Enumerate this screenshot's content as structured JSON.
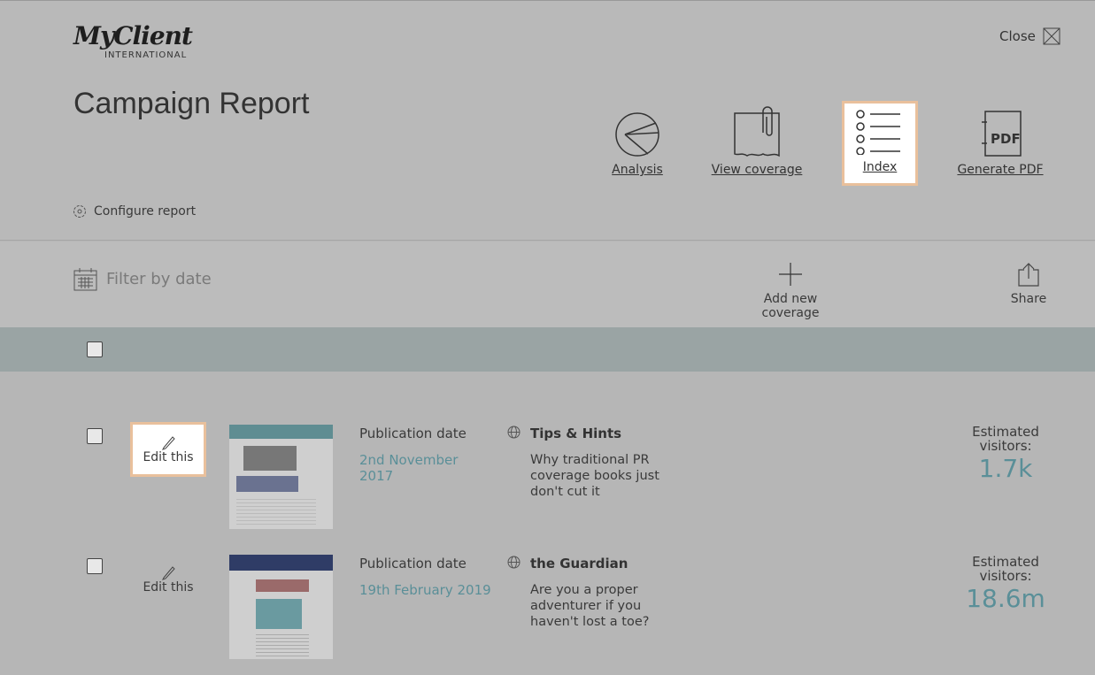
{
  "header": {
    "logo_main": "MyClient",
    "logo_sub": "INTERNATIONAL",
    "title": "Campaign Report",
    "close_label": "Close",
    "configure_label": "Configure report"
  },
  "actions": [
    {
      "label": "Analysis",
      "icon": "pie-chart-icon"
    },
    {
      "label": "View coverage",
      "icon": "clipping-icon"
    },
    {
      "label": "Index",
      "icon": "list-icon",
      "selected": true
    },
    {
      "label": "Generate PDF",
      "icon": "pdf-icon",
      "icon_text": "PDF"
    }
  ],
  "toolbar": {
    "filter_placeholder": "Filter by date",
    "add_label": "Add new coverage",
    "share_label": "Share"
  },
  "rows": [
    {
      "edit_label": "Edit this",
      "date_label": "Publication date",
      "date": "2nd November 2017",
      "publication": "Tips & Hints",
      "headline": "Why traditional PR coverage books just don't cut it",
      "visitors_label": "Estimated visitors:",
      "visitors": "1.7k"
    },
    {
      "edit_label": "Edit this",
      "date_label": "Publication date",
      "date": "19th February 2019",
      "publication": "the Guardian",
      "headline": "Are you a proper adventurer if you haven't lost a toe?",
      "visitors_label": "Estimated visitors:",
      "visitors": "18.6m"
    }
  ]
}
